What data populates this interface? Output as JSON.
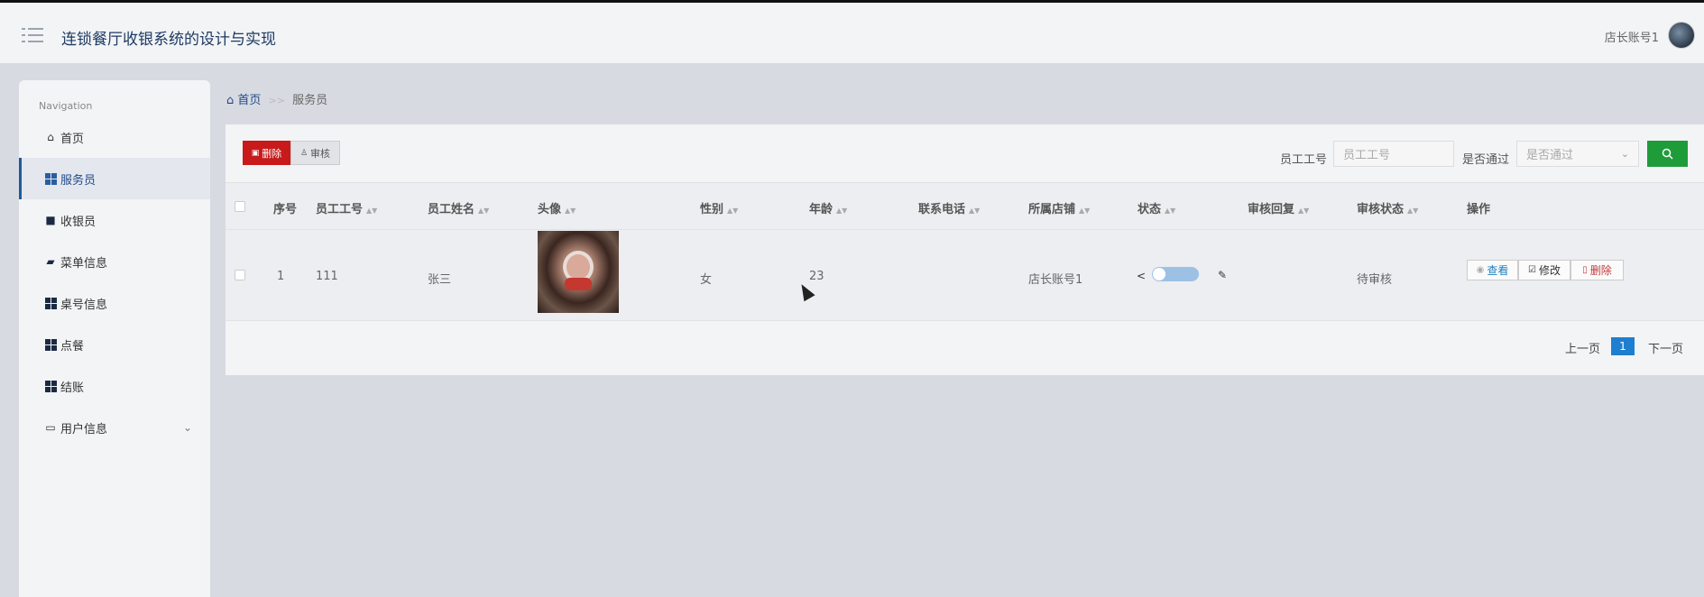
{
  "app": {
    "title": "连锁餐厅收银系统的设计与实现",
    "user": "店长账号1"
  },
  "sidebar": {
    "heading": "Navigation",
    "items": [
      {
        "label": "首页"
      },
      {
        "label": "服务员"
      },
      {
        "label": "收银员"
      },
      {
        "label": "菜单信息"
      },
      {
        "label": "桌号信息"
      },
      {
        "label": "点餐"
      },
      {
        "label": "结账"
      },
      {
        "label": "用户信息"
      }
    ]
  },
  "breadcrumb": {
    "home": "首页",
    "separator": ">>",
    "current": "服务员"
  },
  "toolbar": {
    "delete_label": "删除",
    "audit_label": "审核",
    "filter_id_label": "员工工号",
    "filter_id_placeholder": "员工工号",
    "filter_pass_label": "是否通过",
    "filter_pass_placeholder": "是否通过"
  },
  "table": {
    "columns": [
      "序号",
      "员工工号",
      "员工姓名",
      "头像",
      "性别",
      "年龄",
      "联系电话",
      "所属店铺",
      "状态",
      "审核回复",
      "审核状态",
      "操作"
    ],
    "rows": [
      {
        "index": "1",
        "staff_id": "111",
        "name": "张三",
        "gender": "女",
        "age": "23",
        "phone": "",
        "store": "店长账号1",
        "reply": "",
        "audit_status": "待审核"
      }
    ],
    "actions": {
      "view": "查看",
      "edit": "修改",
      "delete": "删除"
    }
  },
  "pagination": {
    "prev": "上一页",
    "current": "1",
    "next": "下一页"
  },
  "colors": {
    "delete_button": "#c81a1a",
    "search_button": "#1f9c3a",
    "accent": "#1e7fd0"
  }
}
